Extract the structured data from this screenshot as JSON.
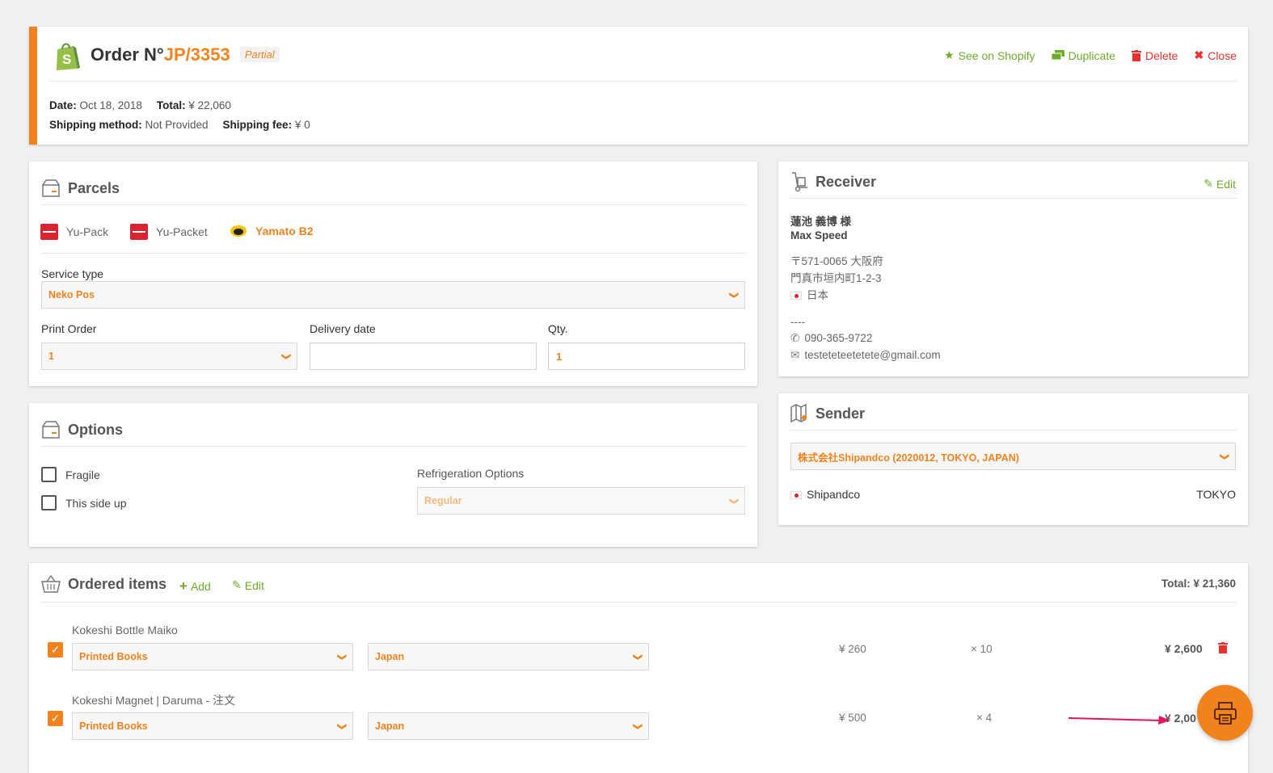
{
  "header": {
    "order_prefix": "Order N°",
    "order_number": "JP/3353",
    "status_badge": "Partial",
    "actions": {
      "see_on_shopify": "See on Shopify",
      "duplicate": "Duplicate",
      "delete": "Delete",
      "close": "Close"
    },
    "date_label": "Date:",
    "date_value": "Oct 18, 2018",
    "total_label": "Total:",
    "total_value": "¥ 22,060",
    "shipping_method_label": "Shipping method:",
    "shipping_method_value": "Not Provided",
    "shipping_fee_label": "Shipping fee:",
    "shipping_fee_value": "¥ 0"
  },
  "parcels": {
    "title": "Parcels",
    "carriers": [
      {
        "label": "Yu-Pack",
        "active": false
      },
      {
        "label": "Yu-Packet",
        "active": false
      },
      {
        "label": "Yamato B2",
        "active": true
      }
    ],
    "service_type_label": "Service type",
    "service_type_value": "Neko Pos",
    "print_order_label": "Print Order",
    "print_order_value": "1",
    "delivery_date_label": "Delivery date",
    "delivery_date_value": "",
    "qty_label": "Qty.",
    "qty_value": "1"
  },
  "options": {
    "title": "Options",
    "fragile_label": "Fragile",
    "this_side_up_label": "This side up",
    "refrigeration_label": "Refrigeration Options",
    "refrigeration_value": "Regular"
  },
  "receiver": {
    "title": "Receiver",
    "edit_label": "Edit",
    "name": "蓮池 義博 様",
    "company": "Max Speed",
    "postal_line": "〒571-0065 大阪府",
    "address_line": "門真市垣内町1-2-3",
    "country": "日本",
    "separator": "----",
    "phone": "090-365-9722",
    "email": "testeteteetetete@gmail.com"
  },
  "sender": {
    "title": "Sender",
    "select_value": "株式会社Shipandco (2020012, TOKYO, JAPAN)",
    "name": "Shipandco",
    "city": "TOKYO"
  },
  "ordered_items": {
    "title": "Ordered items",
    "add_label": "Add",
    "edit_label": "Edit",
    "total": "Total: ¥ 21,360",
    "items": [
      {
        "name": "Kokeshi Bottle Maiko",
        "category": "Printed Books",
        "origin": "Japan",
        "price": "¥ 260",
        "qty": "× 10",
        "line_total": "¥ 2,600"
      },
      {
        "name": "Kokeshi Magnet | Daruma - 注文",
        "category": "Printed Books",
        "origin": "Japan",
        "price": "¥ 500",
        "qty": "× 4",
        "line_total": "¥ 2,00"
      }
    ]
  },
  "colors": {
    "accent_orange": "#f0831e",
    "action_green": "#6cac2a",
    "danger_red": "#e8322f",
    "annotation_arrow": "#e0165e"
  }
}
